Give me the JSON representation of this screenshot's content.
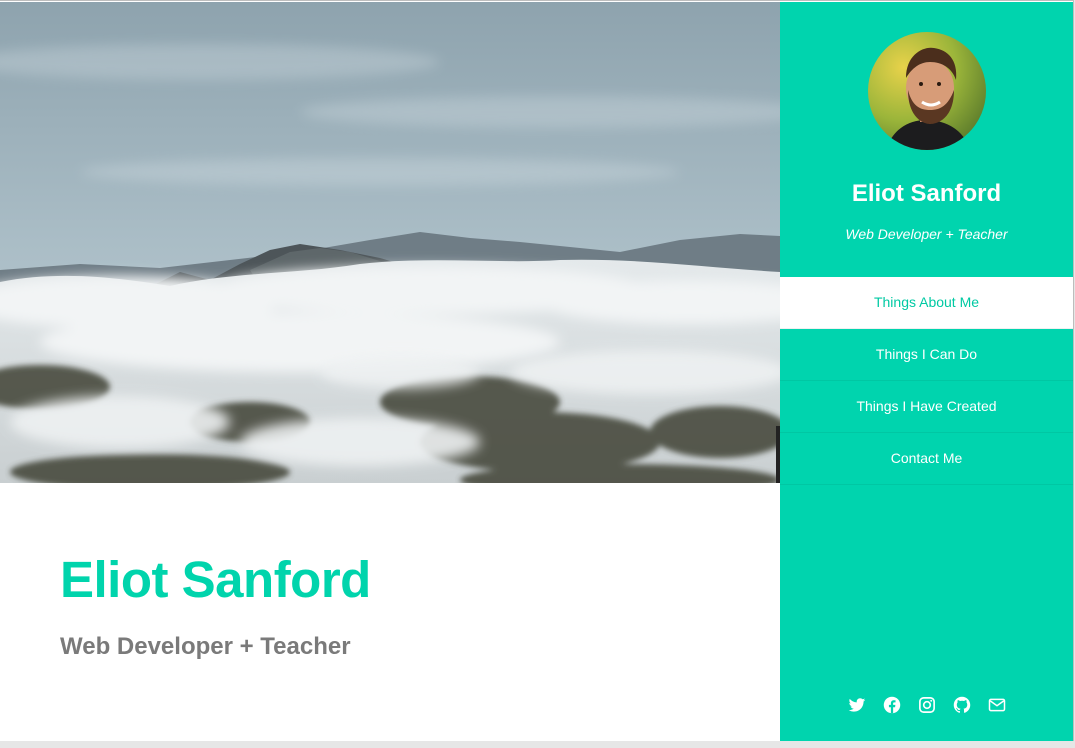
{
  "hero": {
    "name": "Eliot Sanford",
    "tagline": "Web Developer + Teacher"
  },
  "sidebar": {
    "name": "Eliot Sanford",
    "tagline": "Web Developer + Teacher",
    "nav": [
      {
        "label": "Things About Me",
        "active": true
      },
      {
        "label": "Things I Can Do",
        "active": false
      },
      {
        "label": "Things I Have Created",
        "active": false
      },
      {
        "label": "Contact Me",
        "active": false
      }
    ],
    "social_icons": [
      "twitter-icon",
      "facebook-icon",
      "instagram-icon",
      "github-icon",
      "envelope-icon"
    ]
  },
  "colors": {
    "accent": "#00d4ae",
    "heading": "#00d4ac",
    "subheading": "#7a7a7a",
    "active_nav_text": "#00c9a3"
  }
}
